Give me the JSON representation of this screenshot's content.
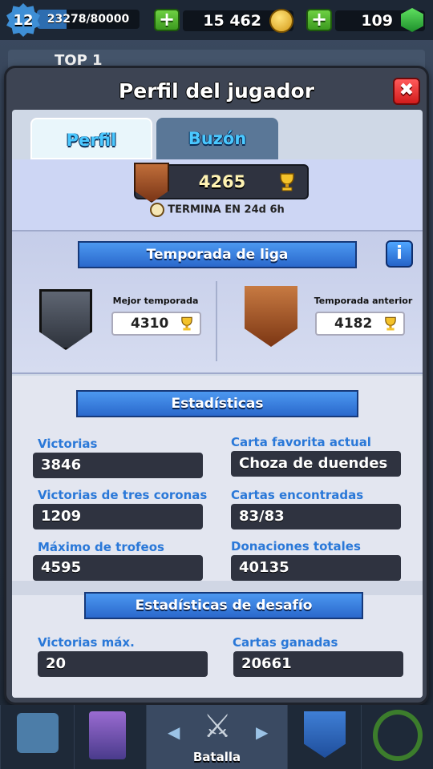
{
  "status": {
    "level": "12",
    "xp": "23278/80000",
    "xp_fraction": 0.29,
    "gold": "15 462",
    "gems": "109"
  },
  "background_strip": {
    "text": "TOP 1"
  },
  "modal": {
    "title": "Perfil del jugador",
    "close_icon": "close-x-icon"
  },
  "tabs": [
    {
      "label": "Perfil",
      "active": true
    },
    {
      "label": "Buzón",
      "active": false
    }
  ],
  "trophies": {
    "value": "4265",
    "ends_text": "TERMINA EN 24d 6h"
  },
  "league": {
    "banner": "Temporada de liga",
    "info": "i",
    "best_label": "Mejor temporada",
    "best_value": "4310",
    "previous_label": "Temporada anterior",
    "previous_value": "4182"
  },
  "stats": {
    "banner": "Estadísticas",
    "items": [
      {
        "label": "Victorias",
        "value": "3846"
      },
      {
        "label": "Carta favorita actual",
        "value": "Choza de duendes"
      },
      {
        "label": "Victorias de tres coronas",
        "value": "1209"
      },
      {
        "label": "Cartas encontradas",
        "value": "83/83"
      },
      {
        "label": "Máximo de trofeos",
        "value": "4595"
      },
      {
        "label": "Donaciones totales",
        "value": "40135"
      }
    ]
  },
  "challenge": {
    "banner": "Estadísticas de desafío",
    "items": [
      {
        "label": "Victorias máx.",
        "value": "20"
      },
      {
        "label": "Cartas ganadas",
        "value": "20661"
      }
    ]
  },
  "nav": {
    "battle_label": "Batalla"
  },
  "colors": {
    "accent_blue": "#2a78d8",
    "close_red": "#d21c1c",
    "plus_green": "#3c9a1f"
  }
}
